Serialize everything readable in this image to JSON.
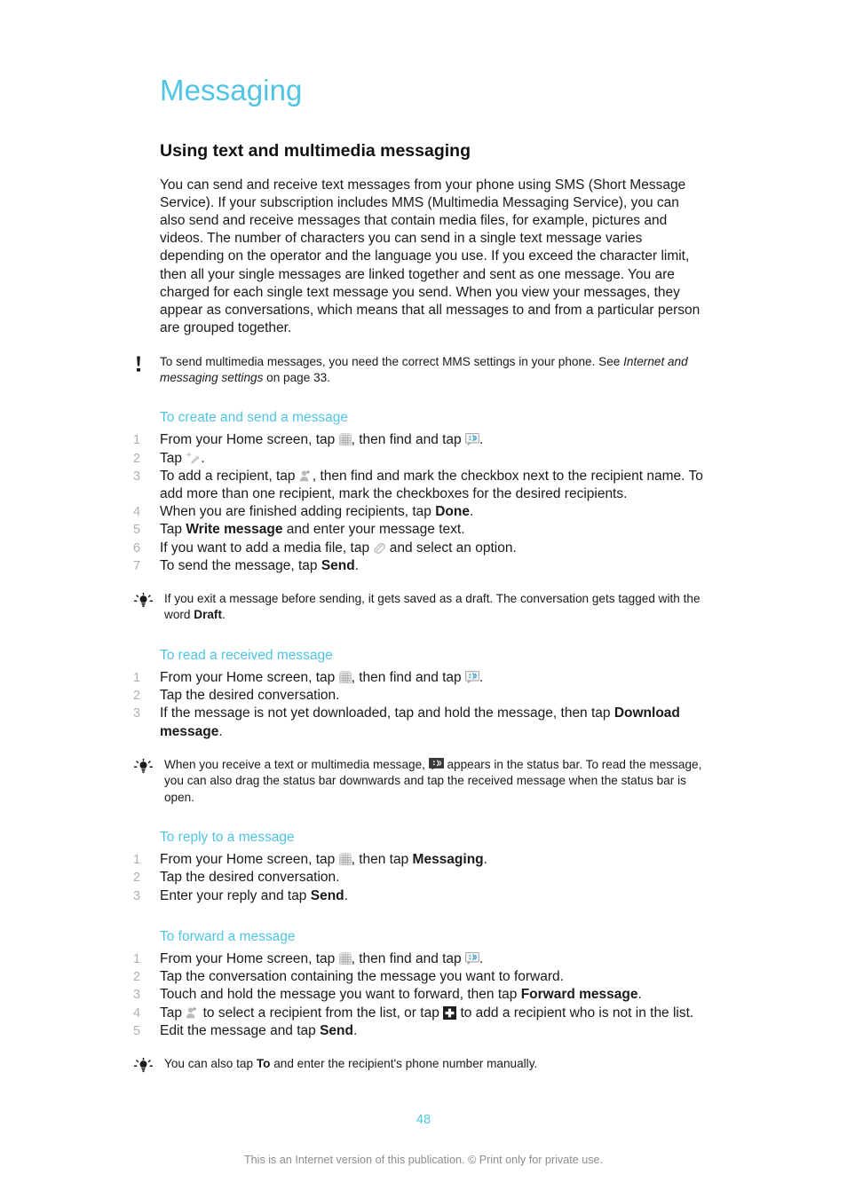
{
  "document": {
    "title": "Messaging",
    "page_number": "48",
    "footer_note": "This is an Internet version of this publication. © Print only for private use.",
    "accent_color": "#4FC4E3",
    "step_number_color": "#b0b0b0"
  },
  "section": {
    "heading": "Using text and multimedia messaging",
    "intro": "You can send and receive text messages from your phone using SMS (Short Message Service). If your subscription includes MMS (Multimedia Messaging Service), you can also send and receive messages that contain media files, for example, pictures and videos. The number of characters you can send in a single text message varies depending on the operator and the language you use. If you exceed the character limit, then all your single messages are linked together and sent as one message. You are charged for each single text message you send. When you view your messages, they appear as conversations, which means that all messages to and from a particular person are grouped together."
  },
  "note": {
    "icon": "exclamation-icon",
    "text_before": "To send multimedia messages, you need the correct MMS settings in your phone. See ",
    "italic": "Internet and messaging settings",
    "text_after": " on page 33."
  },
  "procedures": [
    {
      "title": "To create and send a message",
      "steps": [
        {
          "num": "1",
          "parts": [
            {
              "t": "text",
              "v": "From your Home screen, tap "
            },
            {
              "t": "icon",
              "v": "app-drawer-icon"
            },
            {
              "t": "text",
              "v": ", then find and tap "
            },
            {
              "t": "icon",
              "v": "messaging-icon"
            },
            {
              "t": "text",
              "v": "."
            }
          ]
        },
        {
          "num": "2",
          "parts": [
            {
              "t": "text",
              "v": "Tap "
            },
            {
              "t": "icon",
              "v": "compose-message-icon"
            },
            {
              "t": "text",
              "v": "."
            }
          ]
        },
        {
          "num": "3",
          "parts": [
            {
              "t": "text",
              "v": "To add a recipient, tap "
            },
            {
              "t": "icon",
              "v": "add-person-icon"
            },
            {
              "t": "text",
              "v": ", then find and mark the checkbox next to the recipient name. To add more than one recipient, mark the checkboxes for the desired recipients."
            }
          ]
        },
        {
          "num": "4",
          "parts": [
            {
              "t": "text",
              "v": "When you are finished adding recipients, tap "
            },
            {
              "t": "bold",
              "v": "Done"
            },
            {
              "t": "text",
              "v": "."
            }
          ]
        },
        {
          "num": "5",
          "parts": [
            {
              "t": "text",
              "v": "Tap "
            },
            {
              "t": "bold",
              "v": "Write message"
            },
            {
              "t": "text",
              "v": " and enter your message text."
            }
          ]
        },
        {
          "num": "6",
          "parts": [
            {
              "t": "text",
              "v": "If you want to add a media file, tap "
            },
            {
              "t": "icon",
              "v": "paperclip-icon"
            },
            {
              "t": "text",
              "v": " and select an option."
            }
          ]
        },
        {
          "num": "7",
          "parts": [
            {
              "t": "text",
              "v": "To send the message, tap "
            },
            {
              "t": "bold",
              "v": "Send"
            },
            {
              "t": "text",
              "v": "."
            }
          ]
        }
      ],
      "tip": {
        "icon": "lightbulb-icon",
        "parts": [
          {
            "t": "text",
            "v": "If you exit a message before sending, it gets saved as a draft. The conversation gets tagged with the word "
          },
          {
            "t": "bold",
            "v": "Draft"
          },
          {
            "t": "text",
            "v": "."
          }
        ]
      }
    },
    {
      "title": "To read a received message",
      "steps": [
        {
          "num": "1",
          "parts": [
            {
              "t": "text",
              "v": "From your Home screen, tap "
            },
            {
              "t": "icon",
              "v": "app-drawer-icon"
            },
            {
              "t": "text",
              "v": ", then find and tap "
            },
            {
              "t": "icon",
              "v": "messaging-icon"
            },
            {
              "t": "text",
              "v": "."
            }
          ]
        },
        {
          "num": "2",
          "parts": [
            {
              "t": "text",
              "v": "Tap the desired conversation."
            }
          ]
        },
        {
          "num": "3",
          "parts": [
            {
              "t": "text",
              "v": "If the message is not yet downloaded, tap and hold the message, then tap "
            },
            {
              "t": "bold",
              "v": "Download message"
            },
            {
              "t": "text",
              "v": "."
            }
          ]
        }
      ],
      "tip": {
        "icon": "lightbulb-icon",
        "parts": [
          {
            "t": "text",
            "v": "When you receive a text or multimedia message, "
          },
          {
            "t": "icon",
            "v": "status-bar-message-icon"
          },
          {
            "t": "text",
            "v": " appears in the status bar. To read the message, you can also drag the status bar downwards and tap the received message when the status bar is open."
          }
        ]
      }
    },
    {
      "title": "To reply to a message",
      "steps": [
        {
          "num": "1",
          "parts": [
            {
              "t": "text",
              "v": "From your Home screen, tap "
            },
            {
              "t": "icon",
              "v": "app-drawer-icon"
            },
            {
              "t": "text",
              "v": ", then tap "
            },
            {
              "t": "bold",
              "v": "Messaging"
            },
            {
              "t": "text",
              "v": "."
            }
          ]
        },
        {
          "num": "2",
          "parts": [
            {
              "t": "text",
              "v": "Tap the desired conversation."
            }
          ]
        },
        {
          "num": "3",
          "parts": [
            {
              "t": "text",
              "v": "Enter your reply and tap "
            },
            {
              "t": "bold",
              "v": "Send"
            },
            {
              "t": "text",
              "v": "."
            }
          ]
        }
      ]
    },
    {
      "title": "To forward a message",
      "steps": [
        {
          "num": "1",
          "parts": [
            {
              "t": "text",
              "v": "From your Home screen, tap "
            },
            {
              "t": "icon",
              "v": "app-drawer-icon"
            },
            {
              "t": "text",
              "v": ", then find and tap "
            },
            {
              "t": "icon",
              "v": "messaging-icon"
            },
            {
              "t": "text",
              "v": "."
            }
          ]
        },
        {
          "num": "2",
          "parts": [
            {
              "t": "text",
              "v": "Tap the conversation containing the message you want to forward."
            }
          ]
        },
        {
          "num": "3",
          "parts": [
            {
              "t": "text",
              "v": "Touch and hold the message you want to forward, then tap "
            },
            {
              "t": "bold",
              "v": "Forward message"
            },
            {
              "t": "text",
              "v": "."
            }
          ]
        },
        {
          "num": "4",
          "parts": [
            {
              "t": "text",
              "v": "Tap "
            },
            {
              "t": "icon",
              "v": "add-person-icon"
            },
            {
              "t": "text",
              "v": " to select a recipient from the list, or tap "
            },
            {
              "t": "icon",
              "v": "plus-box-icon"
            },
            {
              "t": "text",
              "v": " to add a recipient who is not in the list."
            }
          ]
        },
        {
          "num": "5",
          "parts": [
            {
              "t": "text",
              "v": "Edit the message and tap "
            },
            {
              "t": "bold",
              "v": "Send"
            },
            {
              "t": "text",
              "v": "."
            }
          ]
        }
      ],
      "tip": {
        "icon": "lightbulb-icon",
        "parts": [
          {
            "t": "text",
            "v": "You can also tap "
          },
          {
            "t": "bold",
            "v": "To"
          },
          {
            "t": "text",
            "v": " and enter the recipient's phone number manually."
          }
        ]
      }
    }
  ]
}
